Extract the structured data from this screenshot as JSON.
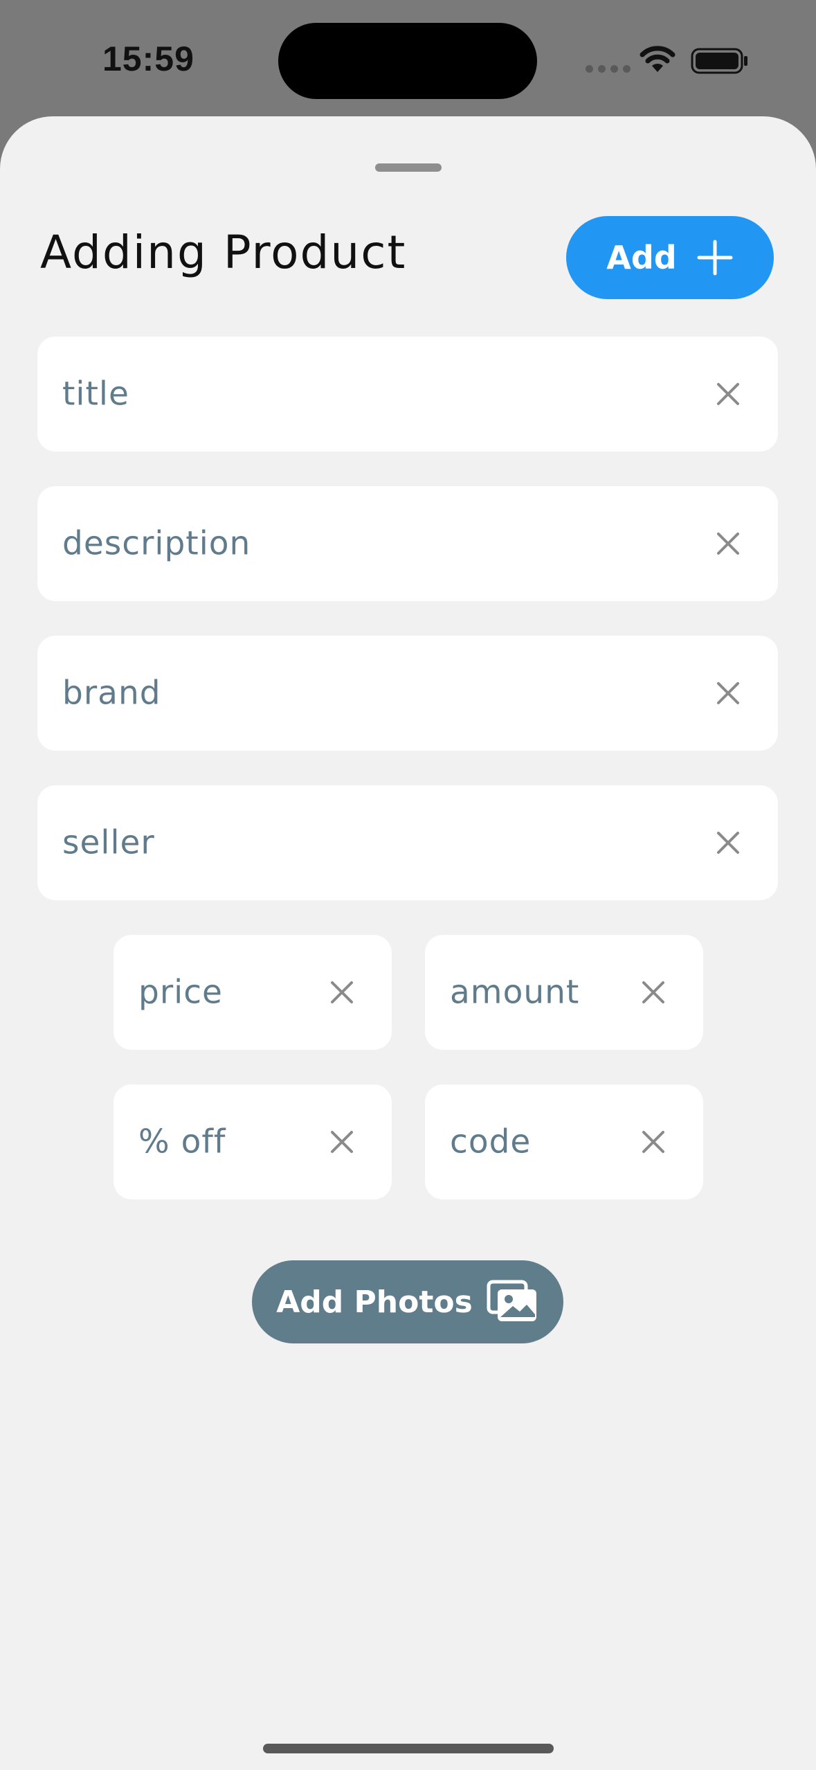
{
  "status_bar": {
    "time": "15:59",
    "signal_icon": "cellular-signal-icon",
    "wifi_icon": "wifi-icon",
    "battery_icon": "battery-icon"
  },
  "sheet": {
    "title": "Adding Product",
    "add_button": {
      "label": "Add",
      "icon": "plus-icon",
      "color": "#2196f3"
    },
    "fields": {
      "title": "title",
      "description": "description",
      "brand": "brand",
      "seller": "seller",
      "price": "price",
      "amount": "amount",
      "percent_off": "% off",
      "code": "code"
    },
    "clear_icon": "close-icon",
    "add_photos_button": {
      "label": "Add Photos",
      "icon": "photos-icon",
      "color": "#607d8b"
    }
  },
  "colors": {
    "background_dim": "#7a7a7a",
    "sheet": "#f1f1f1",
    "field": "#ffffff",
    "placeholder": "#5f7b8c",
    "clear_icon": "#8a8a8a"
  }
}
